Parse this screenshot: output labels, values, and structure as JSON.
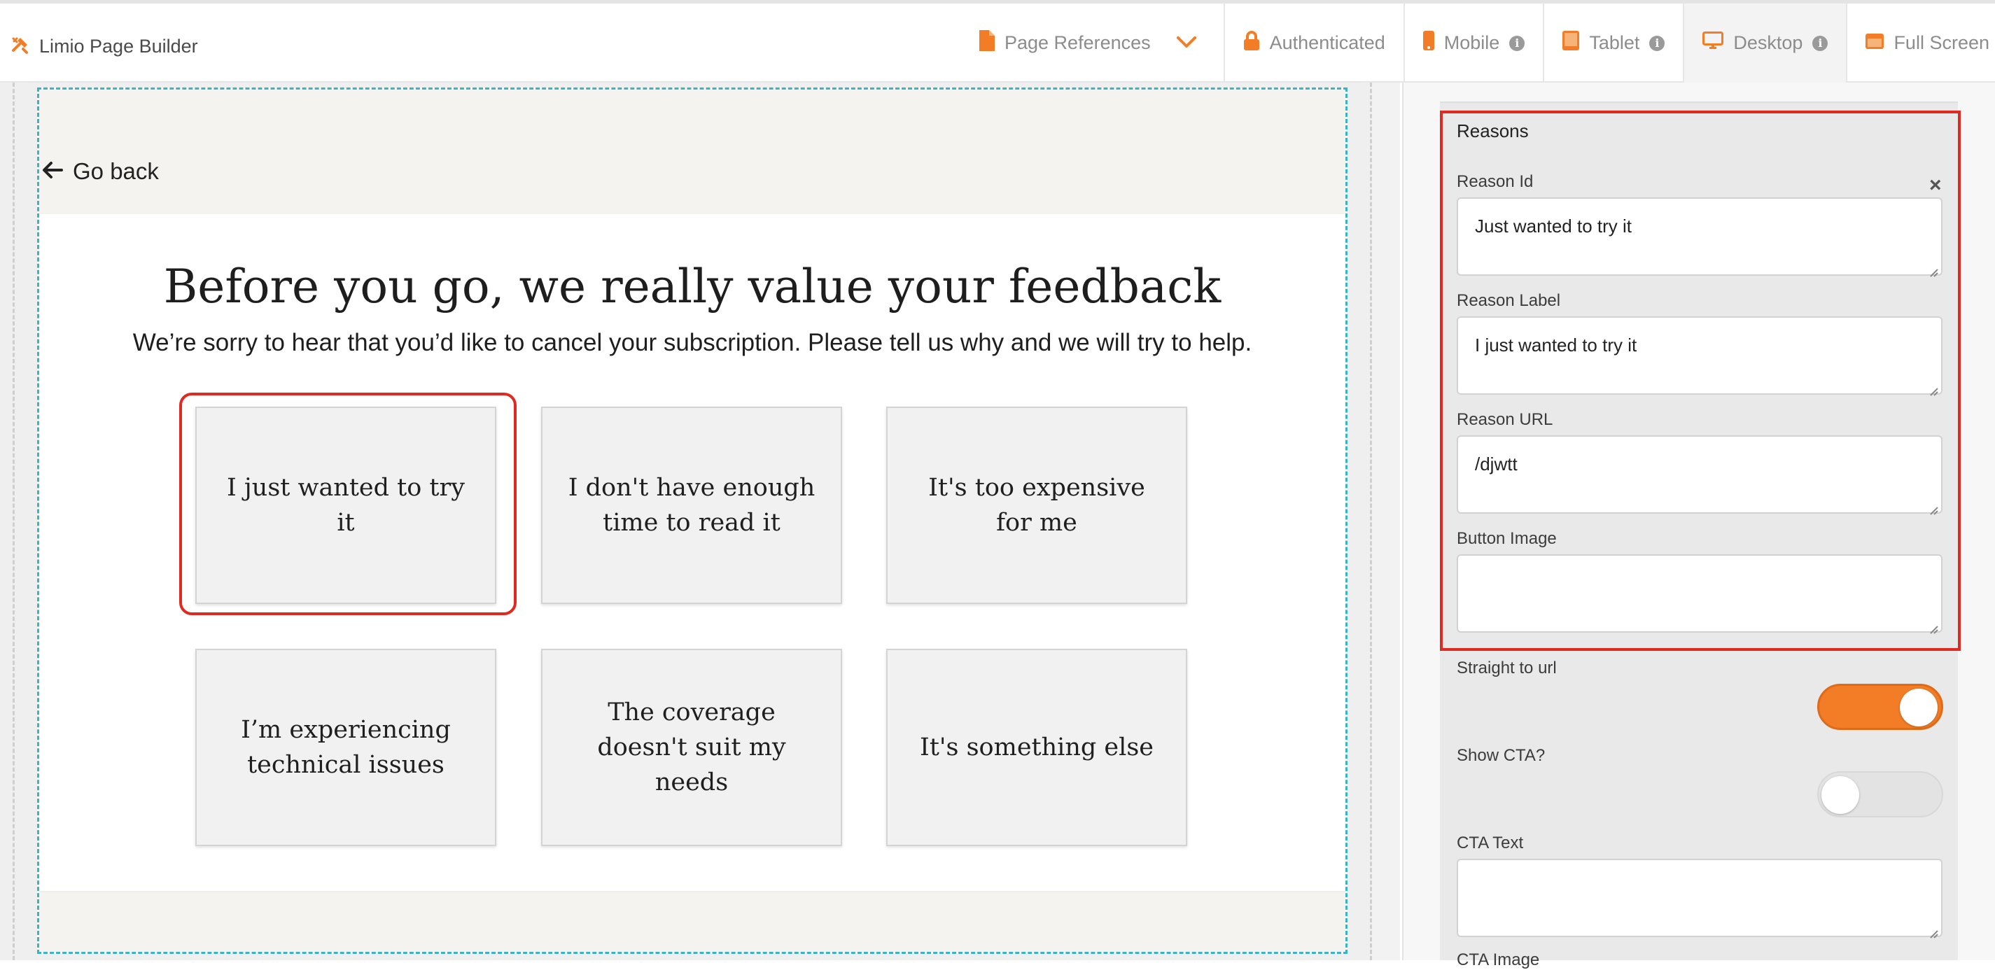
{
  "app": {
    "title": "Limio Page Builder"
  },
  "toolbar": {
    "tabs": [
      {
        "label": "Page References",
        "icon": "document-icon"
      },
      {
        "label": "Authenticated",
        "icon": "lock-icon"
      },
      {
        "label": "Mobile",
        "icon": "mobile-icon"
      },
      {
        "label": "Tablet",
        "icon": "tablet-icon"
      },
      {
        "label": "Desktop",
        "icon": "desktop-icon",
        "active": true
      },
      {
        "label": "Full Screen",
        "icon": "fullscreen-icon"
      }
    ],
    "info_glyph": "i"
  },
  "page": {
    "go_back": "Go back",
    "title": "Before you go, we really value your feedback",
    "subtitle": "We’re sorry to hear that you’d like to cancel your subscription. Please tell us why and we will try to help.",
    "reasons": [
      "I just wanted to try it",
      "I don't have enough time to read it",
      "It's too expensive for me",
      "I’m experiencing technical issues",
      "The coverage doesn't suit my needs",
      "It's something else"
    ]
  },
  "panel": {
    "heading": "Reasons",
    "reason_id_label": "Reason Id",
    "reason_id_value": "Just wanted to try it",
    "reason_label_label": "Reason Label",
    "reason_label_value": "I just wanted to try it",
    "reason_url_label": "Reason URL",
    "reason_url_value": "/djwtt",
    "button_image_label": "Button Image",
    "button_image_value": "",
    "straight_to_url_label": "Straight to url",
    "straight_to_url_on": true,
    "show_cta_label": "Show CTA?",
    "show_cta_on": false,
    "cta_text_label": "CTA Text",
    "cta_text_value": "",
    "cta_image_label": "CTA Image",
    "remove_glyph": "×"
  },
  "colors": {
    "accent": "#f27d26",
    "highlight": "#e02a1f",
    "canvas_outline": "#38b4c4"
  }
}
